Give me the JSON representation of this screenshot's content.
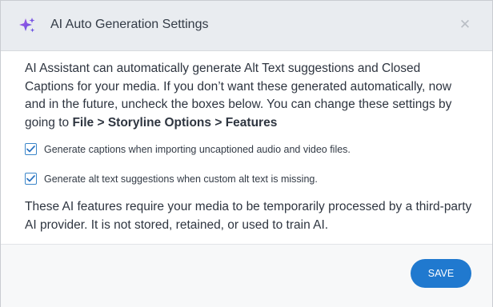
{
  "dialog": {
    "title": "AI Auto Generation Settings",
    "title_icon": "sparkle-icon",
    "close_icon": "close-icon",
    "close_glyph": "✕",
    "accent_color": "#8a4ee0"
  },
  "intro": {
    "text": "AI Assistant can automatically generate Alt Text suggestions and Closed Captions for your media. If you don’t want these generated automatically, now and in the future, uncheck the boxes below. You can change these settings by going to ",
    "path_file": "File",
    "path_sep1": " > ",
    "path_storyline": "Storyline Options",
    "path_sep2": " > ",
    "path_features": "Features"
  },
  "options": [
    {
      "label": "Generate captions when importing uncaptioned audio and video files.",
      "checked": true
    },
    {
      "label": "Generate alt text suggestions when custom alt text is missing.",
      "checked": true
    }
  ],
  "note": "These AI features require your media to be temporarily processed by a third-party AI provider. It is not stored, retained, or used to train AI.",
  "footer": {
    "save_label": "SAVE",
    "save_color": "#2079cf"
  }
}
